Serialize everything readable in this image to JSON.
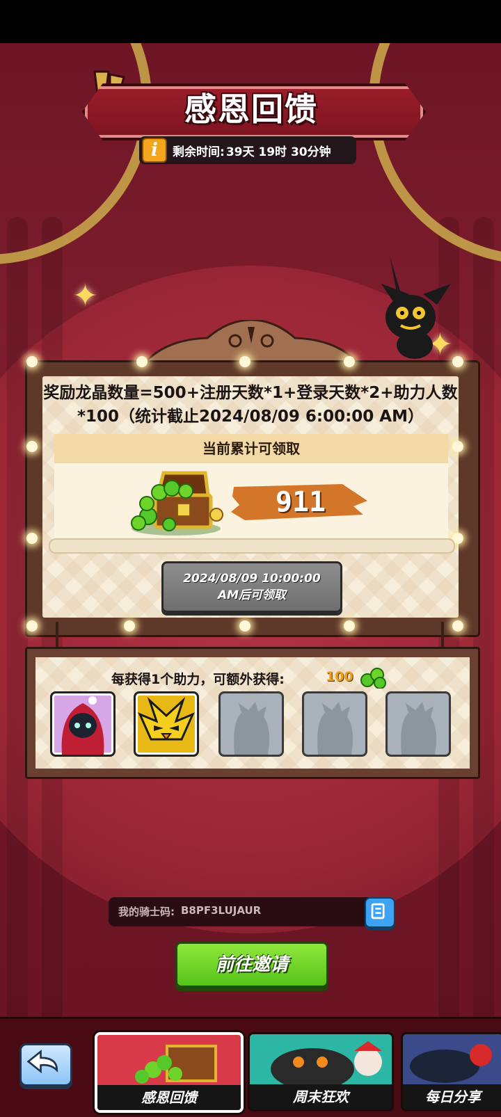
{
  "event": {
    "title": "感恩回馈",
    "time_label": "剩余时间:",
    "time_value": "39天 19时 30分钟"
  },
  "reward": {
    "formula": "奖励龙晶数量=500+注册天数*1+登录天数*2+助力人数*100（统计截止2024/08/09 6:00:00 AM）",
    "current_label": "当前累计可领取",
    "amount": "911",
    "claim_button": "2024/08/09 10:00:00 AM后可领取"
  },
  "helpers": {
    "text": "每获得1个助力，可额外获得:",
    "bonus": "100",
    "slots": [
      {
        "state": "filled",
        "hero": "hooded-hero"
      },
      {
        "state": "filled",
        "hero": "yellow-bird-hero"
      },
      {
        "state": "empty"
      },
      {
        "state": "empty"
      },
      {
        "state": "empty"
      }
    ]
  },
  "knight_code": {
    "label": "我的骑士码:",
    "value": "B8PF3LUJAUR"
  },
  "invite_button": "前往邀请",
  "tabs": [
    {
      "label": "感恩回馈",
      "active": true
    },
    {
      "label": "周末狂欢",
      "active": false
    },
    {
      "label": "每日分享",
      "active": false
    }
  ],
  "colors": {
    "accent_gold": "#f3a51d",
    "invite_green": "#6ed42a",
    "copy_blue": "#3ea3f2",
    "banner_red": "#8b1a26"
  }
}
